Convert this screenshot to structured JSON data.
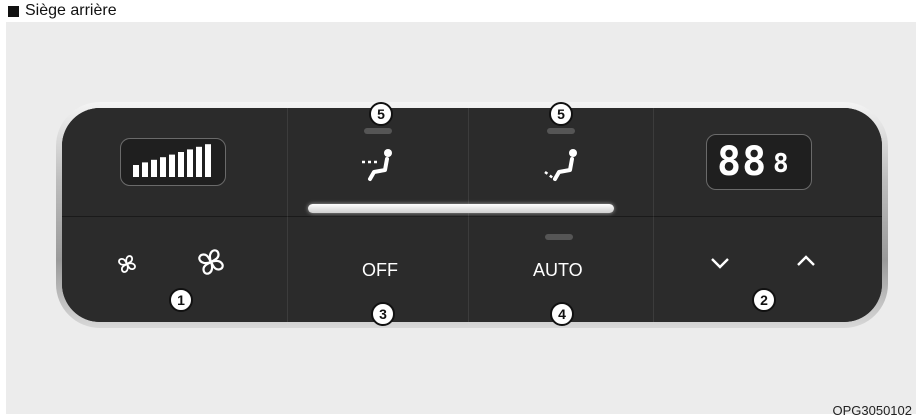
{
  "caption": {
    "text": "Siège arrière"
  },
  "figure_ref": "OPG3050102",
  "panel": {
    "temp_display": {
      "digits": "88",
      "sub_digit": "8"
    },
    "fan_level": {
      "bars": 9
    },
    "buttons": {
      "off_label": "OFF",
      "auto_label": "AUTO"
    },
    "callouts": [
      "1",
      "2",
      "3",
      "4",
      "5",
      "5"
    ]
  },
  "icons": {
    "fan_low": "fan-small-icon",
    "fan_high": "fan-large-icon",
    "face_vent": "mode-face-icon",
    "floor_vent": "mode-floor-icon",
    "temp_down": "chevron-down-icon",
    "temp_up": "chevron-up-icon"
  },
  "colors": {
    "panel": "#2b2b2b",
    "text": "#ffffff"
  }
}
